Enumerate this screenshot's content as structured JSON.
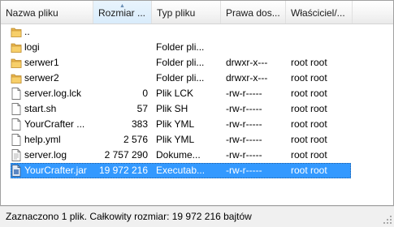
{
  "columns": {
    "name": "Nazwa pliku",
    "size": "Rozmiar ...",
    "type": "Typ pliku",
    "permissions": "Prawa dos...",
    "owner": "Właściciel/..."
  },
  "sorted_column": "size",
  "accent_color": "#3399ff",
  "folder_color": "#e8b44a",
  "files": [
    {
      "name": "..",
      "size": "",
      "type": "",
      "permissions": "",
      "owner": "",
      "icon": "folder-icon"
    },
    {
      "name": "logi",
      "size": "",
      "type": "Folder pli...",
      "permissions": "",
      "owner": "",
      "icon": "folder-icon"
    },
    {
      "name": "serwer1",
      "size": "",
      "type": "Folder pli...",
      "permissions": "drwxr-x---",
      "owner": "root root",
      "icon": "folder-icon"
    },
    {
      "name": "serwer2",
      "size": "",
      "type": "Folder pli...",
      "permissions": "drwxr-x---",
      "owner": "root root",
      "icon": "folder-icon"
    },
    {
      "name": "server.log.lck",
      "size": "0",
      "type": "Plik LCK",
      "permissions": "-rw-r-----",
      "owner": "root root",
      "icon": "file-icon"
    },
    {
      "name": "start.sh",
      "size": "57",
      "type": "Plik SH",
      "permissions": "-rw-r-----",
      "owner": "root root",
      "icon": "file-icon"
    },
    {
      "name": "YourCrafter ...",
      "size": "383",
      "type": "Plik YML",
      "permissions": "-rw-r-----",
      "owner": "root root",
      "icon": "file-icon"
    },
    {
      "name": "help.yml",
      "size": "2 576",
      "type": "Plik YML",
      "permissions": "-rw-r-----",
      "owner": "root root",
      "icon": "file-icon"
    },
    {
      "name": "server.log",
      "size": "2 757 290",
      "type": "Dokume...",
      "permissions": "-rw-r-----",
      "owner": "root root",
      "icon": "text-document-icon"
    },
    {
      "name": "YourCrafter.jar",
      "size": "19 972 216",
      "type": "Executab...",
      "permissions": "-rw-r-----",
      "owner": "root root",
      "icon": "jar-file-icon",
      "selected": true
    }
  ],
  "status": {
    "text": "Zaznaczono 1 plik. Całkowity rozmiar: 19 972 216 bajtów"
  }
}
